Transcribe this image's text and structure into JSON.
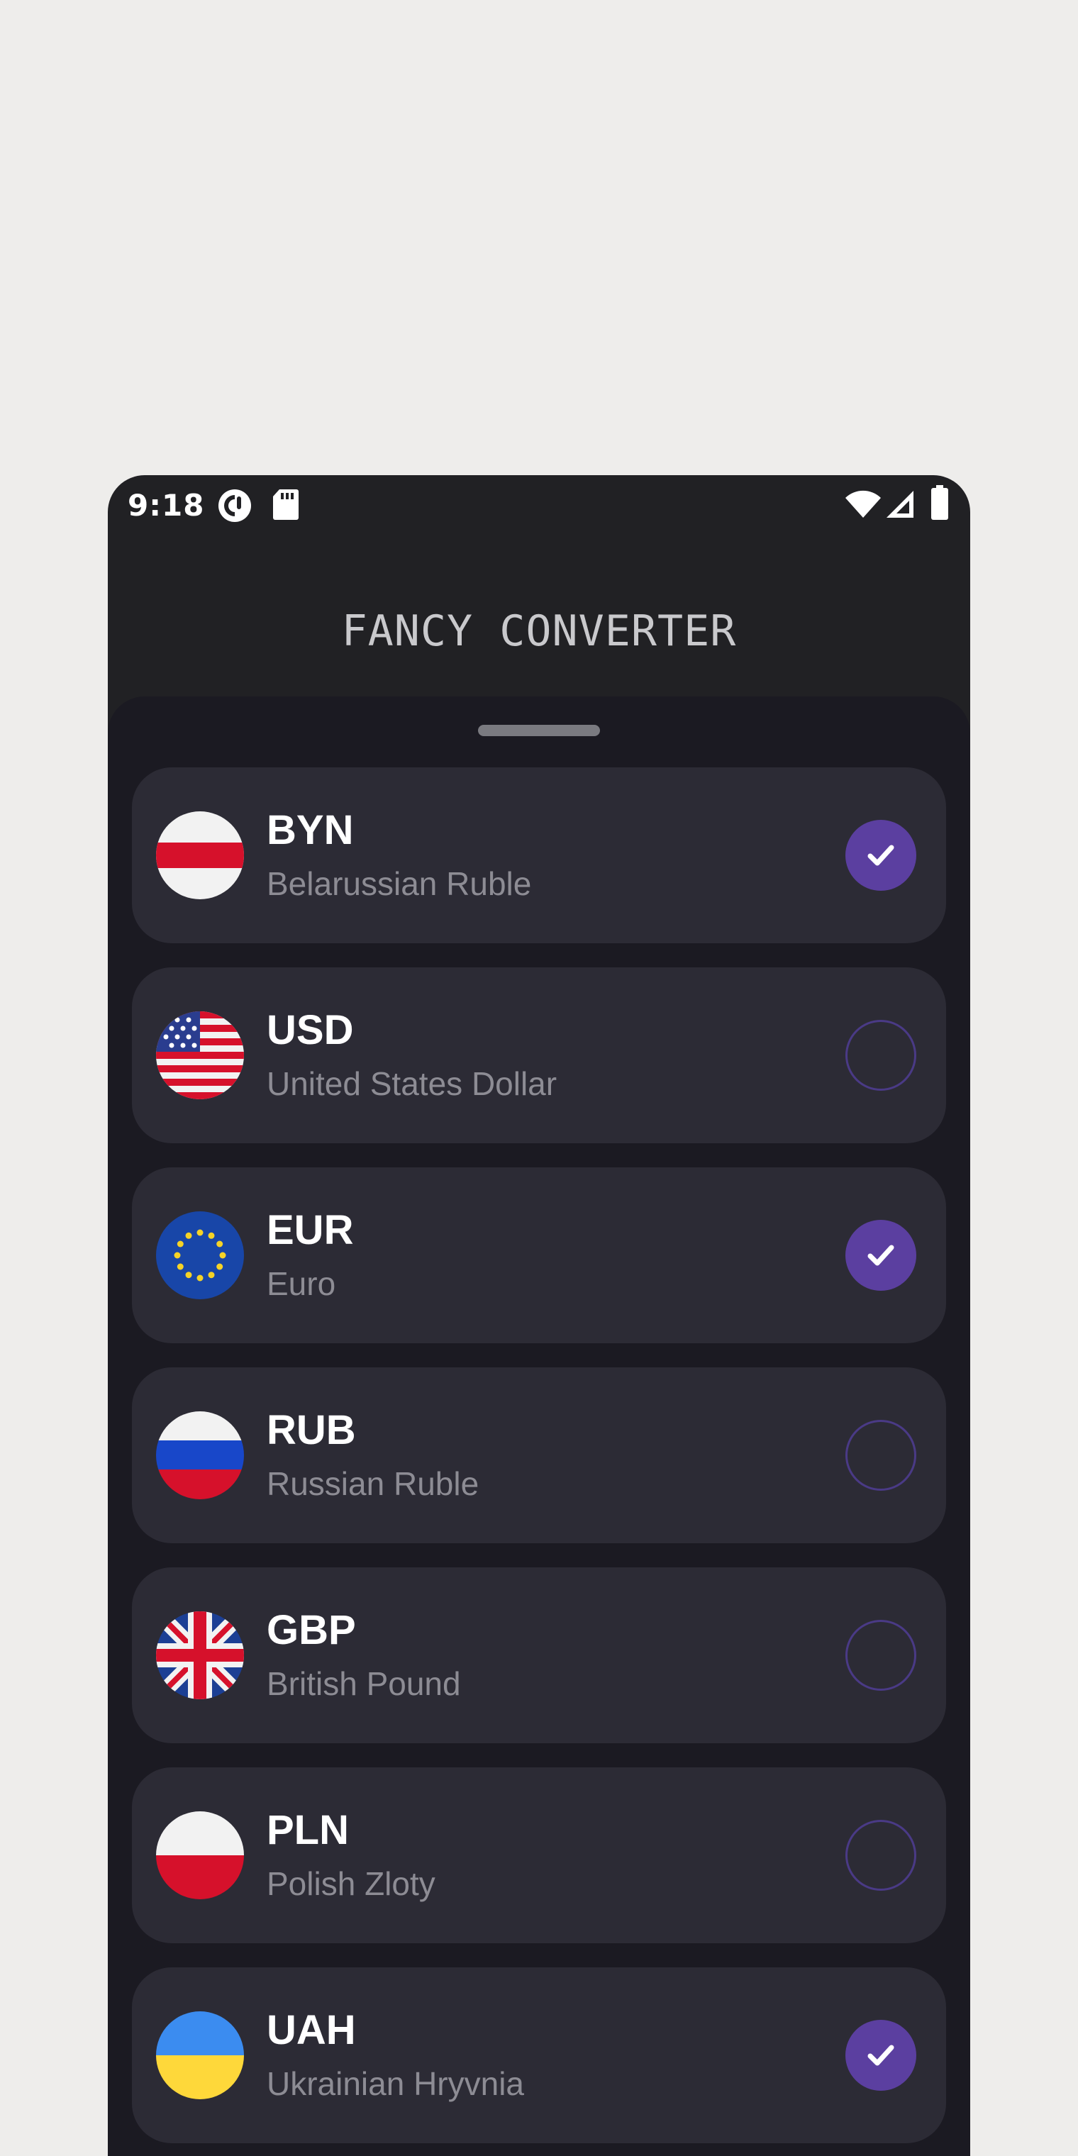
{
  "status_bar": {
    "time": "9:18",
    "icons": [
      "pocket-casts-icon",
      "sd-card-icon",
      "wifi-icon",
      "signal-icon",
      "battery-icon"
    ]
  },
  "app": {
    "title": "FANCY CONVERTER"
  },
  "currencies": [
    {
      "code": "BYN",
      "name": "Belarussian Ruble",
      "flag": "belarus-flag-icon",
      "selected": true
    },
    {
      "code": "USD",
      "name": "United States Dollar",
      "flag": "usa-flag-icon",
      "selected": false
    },
    {
      "code": "EUR",
      "name": "Euro",
      "flag": "eu-flag-icon",
      "selected": true
    },
    {
      "code": "RUB",
      "name": "Russian Ruble",
      "flag": "russia-flag-icon",
      "selected": false
    },
    {
      "code": "GBP",
      "name": "British Pound",
      "flag": "uk-flag-icon",
      "selected": false
    },
    {
      "code": "PLN",
      "name": "Polish Zloty",
      "flag": "poland-flag-icon",
      "selected": false
    },
    {
      "code": "UAH",
      "name": "Ukrainian Hryvnia",
      "flag": "ukraine-flag-icon",
      "selected": true
    }
  ],
  "colors": {
    "background": "#eeedeb",
    "toolbar": "#212124",
    "sheet": "#1b1a22",
    "card": "#2c2b35",
    "accent": "#5b3fa0"
  }
}
